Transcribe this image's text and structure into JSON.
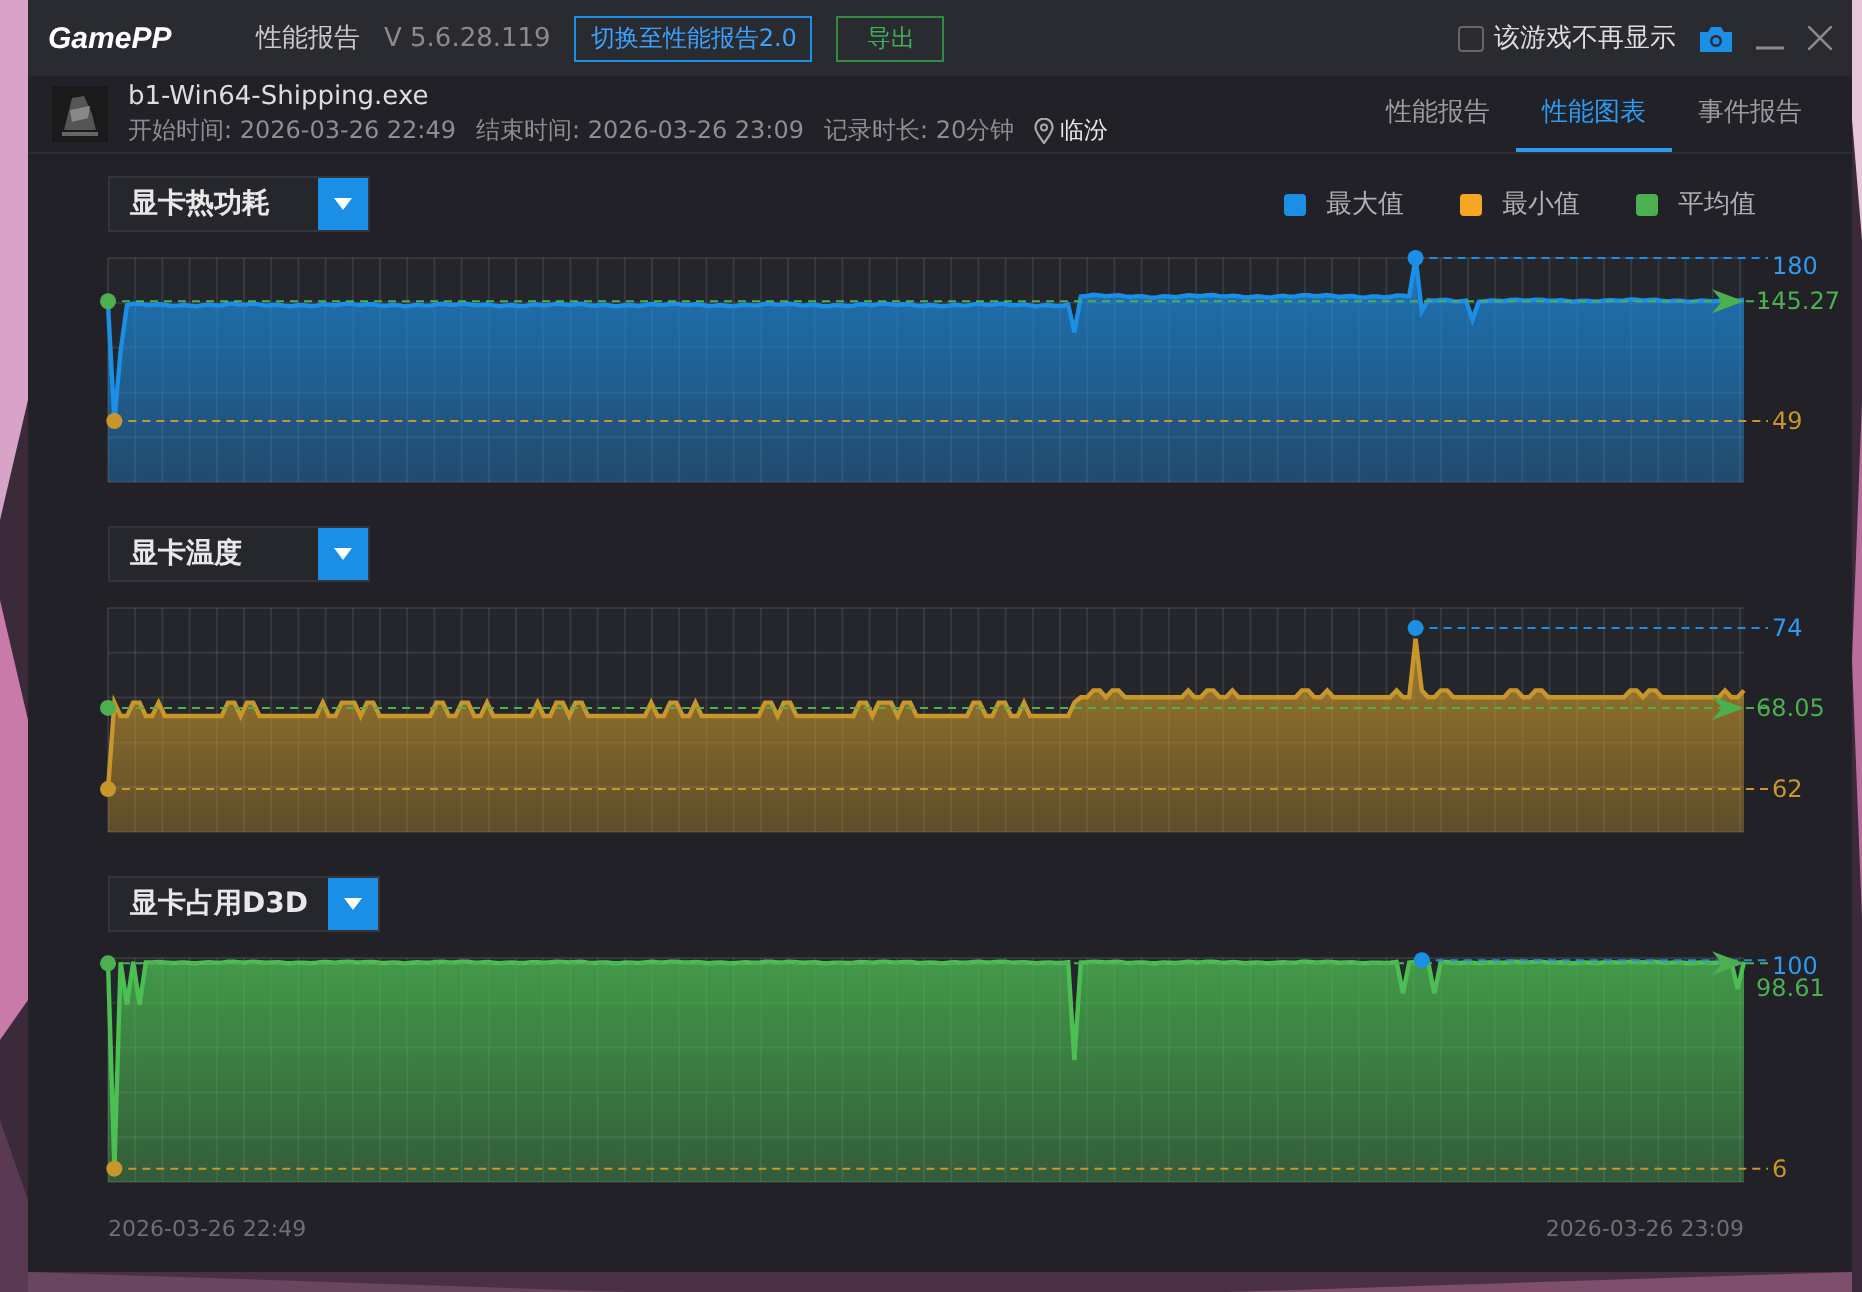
{
  "title_bar": {
    "logo": "GamePP",
    "title": "性能报告",
    "version": "V 5.6.28.119",
    "switch_button": "切换至性能报告2.0",
    "export_button": "导出",
    "hide_checkbox": {
      "label": "该游戏不再显示",
      "checked": false
    }
  },
  "session": {
    "exe": "b1-Win64-Shipping.exe",
    "start": "开始时间: 2026-03-26 22:49",
    "end": "结束时间: 2026-03-26 23:09",
    "duration": "记录时长: 20分钟",
    "location": "临汾"
  },
  "tabs": [
    {
      "label": "性能报告",
      "selected": false
    },
    {
      "label": "性能图表",
      "selected": true
    },
    {
      "label": "事件报告",
      "selected": false
    }
  ],
  "legend": [
    {
      "label": "最大值",
      "color": "#1b8fe6"
    },
    {
      "label": "最小值",
      "color": "#f5a623"
    },
    {
      "label": "平均值",
      "color": "#4caf50"
    }
  ],
  "charts": [
    {
      "metric": "显卡热功耗",
      "max": "180",
      "min": "49",
      "avg": "145.27",
      "color": "#1b8fe6"
    },
    {
      "metric": "显卡温度",
      "max": "74",
      "min": "62",
      "avg": "68.05",
      "color": "#c8962a"
    },
    {
      "metric": "显卡占用D3D",
      "max": "100",
      "min": "6",
      "avg": "98.61",
      "color": "#4cbf52"
    }
  ],
  "time_axis": {
    "start": "2026-03-26 22:49",
    "end": "2026-03-26 23:09"
  }
}
